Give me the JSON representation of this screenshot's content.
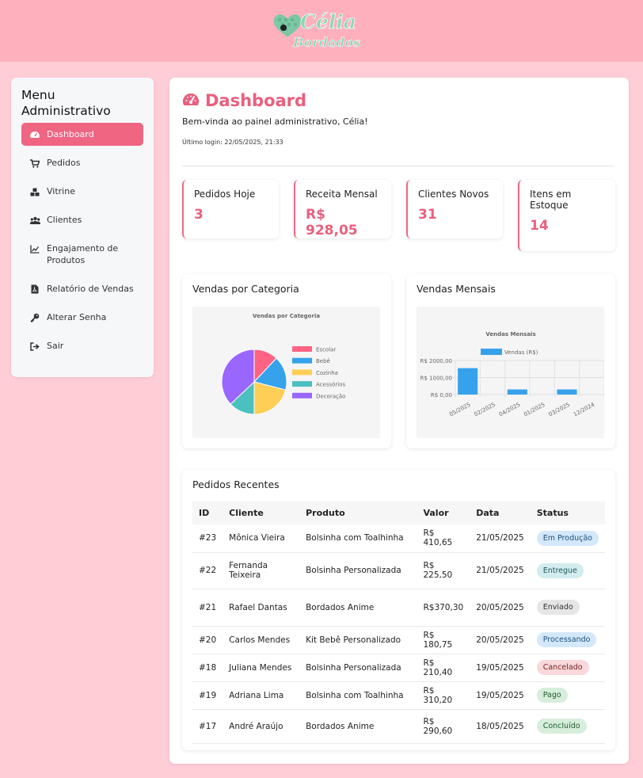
{
  "colors": {
    "accent": "#ef6582",
    "header": "#ffb0bd",
    "background": "#ffcdd6"
  },
  "logo": {
    "line1": "Célia",
    "line2": "Bordados"
  },
  "sidebar": {
    "title": "Menu Administrativo",
    "items": [
      {
        "label": "Dashboard",
        "icon": "gauge-icon",
        "active": true
      },
      {
        "label": "Pedidos",
        "icon": "cart-icon"
      },
      {
        "label": "Vitrine",
        "icon": "boxes-icon"
      },
      {
        "label": "Clientes",
        "icon": "users-icon"
      },
      {
        "label": "Engajamento de Produtos",
        "icon": "line-chart-icon"
      },
      {
        "label": "Relatório de Vendas",
        "icon": "pdf-file-icon"
      },
      {
        "label": "Alterar Senha",
        "icon": "key-icon"
      },
      {
        "label": "Sair",
        "icon": "sign-out-icon"
      }
    ]
  },
  "dashboard": {
    "title": "Dashboard",
    "welcome": "Bem-vinda ao painel administrativo, Célia!",
    "last_login": "Último login: 22/05/2025, 21:33"
  },
  "cards": [
    {
      "label": "Pedidos Hoje",
      "value": "3"
    },
    {
      "label": "Receita Mensal",
      "value": "R$ 928,05"
    },
    {
      "label": "Clientes Novos",
      "value": "31"
    },
    {
      "label": "Itens em Estoque",
      "value": "14"
    }
  ],
  "category_panel": {
    "title": "Vendas por Categoria"
  },
  "monthly_panel": {
    "title": "Vendas Mensais"
  },
  "chart_data": [
    {
      "type": "pie",
      "title": "Vendas por Categoria",
      "categories": [
        "Escolar",
        "Bebê",
        "Cozinha",
        "Acessórios",
        "Decoração"
      ],
      "values": [
        12,
        17,
        21,
        13,
        37
      ],
      "colors": [
        "#ff6384",
        "#36a2eb",
        "#ffce56",
        "#4bc0c0",
        "#9966ff"
      ],
      "legend": "right"
    },
    {
      "type": "bar",
      "title": "Vendas Mensais",
      "categories": [
        "05/2025",
        "02/2025",
        "04/2025",
        "01/2025",
        "03/2025",
        "12/2024"
      ],
      "series": [
        {
          "name": "Vendas (R$)",
          "values": [
            1550,
            0,
            300,
            0,
            300,
            0
          ]
        }
      ],
      "yticks": [
        "R$ 0,00",
        "R$ 1000,00",
        "R$ 2000,00"
      ],
      "ylim": [
        0,
        2000
      ],
      "legend": "top",
      "grid": true,
      "color": "#36a2eb"
    }
  ],
  "orders": {
    "title": "Pedidos Recentes",
    "headers": [
      "ID",
      "Cliente",
      "Produto",
      "Valor",
      "Data",
      "Status"
    ],
    "rows": [
      {
        "id": "#23",
        "cliente": "Mônica Vieira",
        "produto": "Bolsinha com Toalhinha",
        "valor": "R$ 410,65",
        "data": "21/05/2025",
        "status": "Em Produção",
        "bg": "#d4e8fb",
        "fg": "#1f4e79"
      },
      {
        "id": "#22",
        "cliente": "Fernanda Teixeira",
        "produto": "Bolsinha Personalizada",
        "valor": "R$ 225,50",
        "data": "21/05/2025",
        "status": "Entregue",
        "bg": "#d3ecee",
        "fg": "#1c5a60"
      },
      {
        "id": "#21",
        "cliente": "Rafael Dantas",
        "produto": "Bordados Anime",
        "valor": "R$370,30",
        "data": "20/05/2025",
        "status": "Enviado",
        "bg": "#e6e6e6",
        "fg": "#333333"
      },
      {
        "id": "#20",
        "cliente": "Carlos Mendes",
        "produto": "Kit Bebê Personalizado",
        "valor": "R$ 180,75",
        "data": "20/05/2025",
        "status": "Processando",
        "bg": "#d4e8fb",
        "fg": "#1f4e79"
      },
      {
        "id": "#18",
        "cliente": "Juliana Mendes",
        "produto": "Bolsinha Personalizada",
        "valor": "R$ 210,40",
        "data": "19/05/2025",
        "status": "Cancelado",
        "bg": "#f8d8da",
        "fg": "#7a2028"
      },
      {
        "id": "#19",
        "cliente": "Adriana Lima",
        "produto": "Bolsinha com Toalhinha",
        "valor": "R$ 310,20",
        "data": "19/05/2025",
        "status": "Pago",
        "bg": "#d8eedc",
        "fg": "#1e5a2e"
      },
      {
        "id": "#17",
        "cliente": "André Araújo",
        "produto": "Bordados Anime",
        "valor": "R$ 290,60",
        "data": "18/05/2025",
        "status": "Concluído",
        "bg": "#d8eedc",
        "fg": "#1e5a2e"
      }
    ]
  }
}
